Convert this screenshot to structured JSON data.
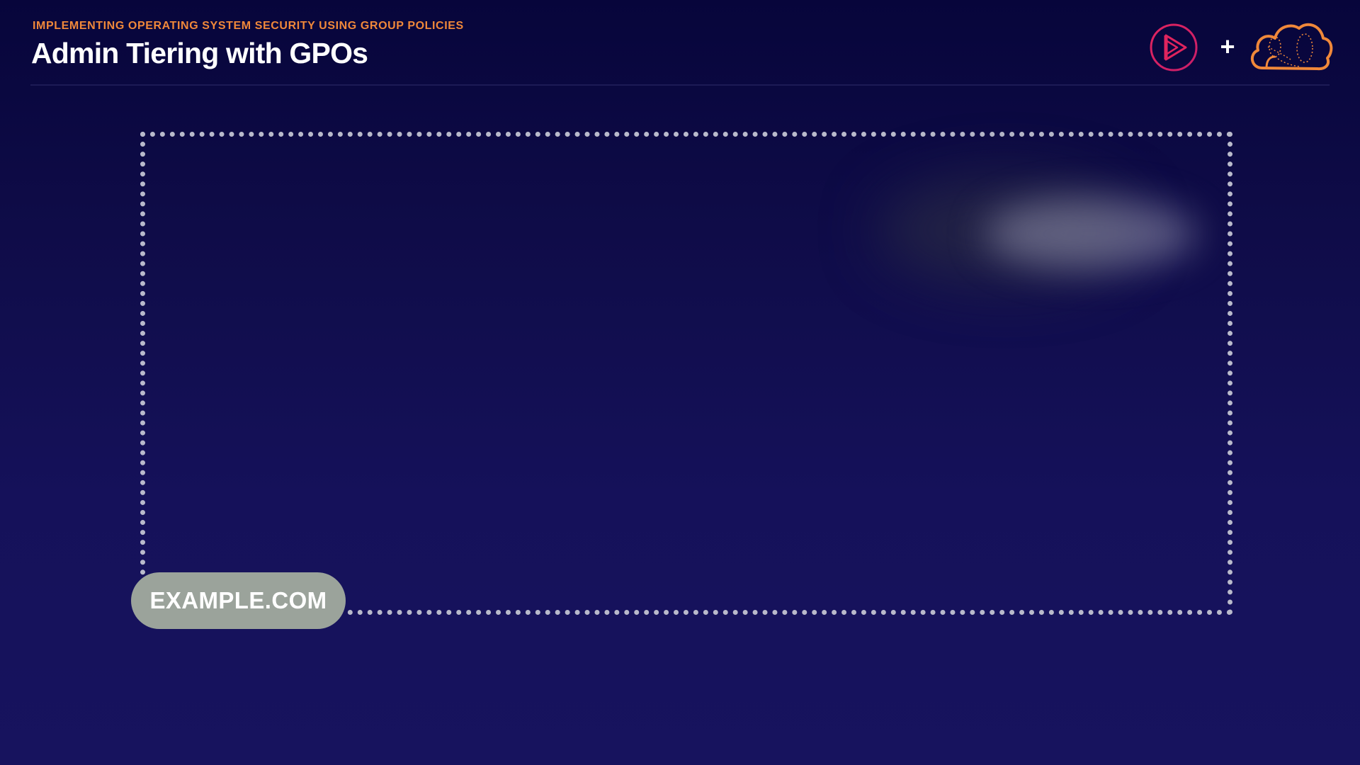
{
  "header": {
    "course_title": "IMPLEMENTING OPERATING SYSTEM SECURITY USING GROUP POLICIES",
    "slide_title": "Admin Tiering with GPOs",
    "accent_color": "#f0883a"
  },
  "logos": {
    "left_icon": "play-icon",
    "plus": "+",
    "right_icon": "cloud-icon"
  },
  "diagram": {
    "domain_label": "EXAMPLE.COM"
  },
  "colors": {
    "background": "#100c4e",
    "play_logo": "#e0245e",
    "cloud_logo": "#f0883a",
    "domain_pill": "#9ba39b",
    "dotted_border": "#b9bacb"
  }
}
